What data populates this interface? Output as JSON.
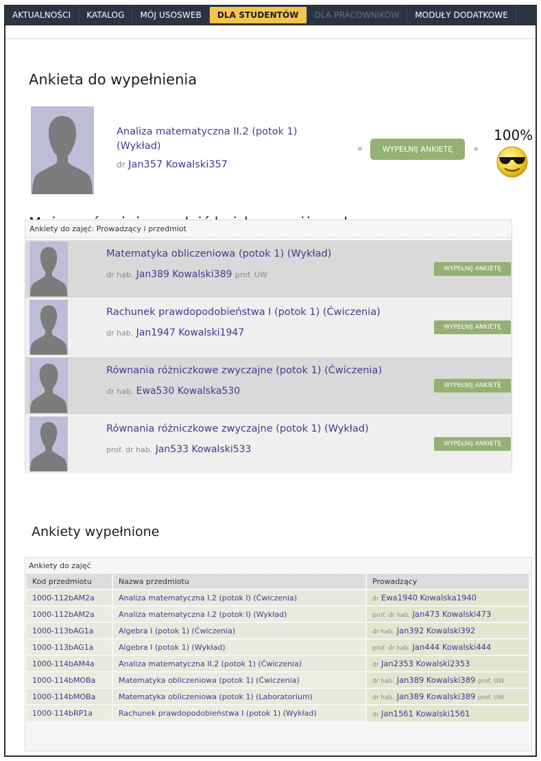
{
  "nav": {
    "tabs": [
      {
        "label": "AKTUALNOŚCI",
        "state": "normal"
      },
      {
        "label": "KATALOG",
        "state": "normal"
      },
      {
        "label": "MÓJ USOSWEB",
        "state": "normal"
      },
      {
        "label": "DLA STUDENTÓW",
        "state": "active"
      },
      {
        "label": "DLA PRACOWNIKÓW",
        "state": "disabled"
      },
      {
        "label": "MODUŁY DODATKOWE",
        "state": "normal"
      }
    ]
  },
  "to_fill": {
    "heading": "Ankieta do wypełnienia",
    "course_line1": "Analiza matematyczna II.2 (potok 1)",
    "course_line2": "(Wykład)",
    "teacher_prefix": "dr",
    "teacher_name": "Jan357 Kowalski357",
    "button": "WYPEŁNIJ ANKIETĘ",
    "progress_text": "100%",
    "progress_value": 1.0
  },
  "also": {
    "heading": "Możesz również wypełnić każdą z poniższych",
    "box_title": "Ankiety do zajęć: Prowadzący i przedmiot",
    "rows": [
      {
        "course": "Matematyka obliczeniowa (potok 1) (Wykład)",
        "pre": "dr hab.",
        "name": "Jan389 Kowalski389",
        "post": "prof. UW",
        "button": "WYPEŁNIJ ANKIETĘ"
      },
      {
        "course": "Rachunek prawdopodobieństwa I (potok 1) (Ćwiczenia)",
        "pre": "dr hab.",
        "name": "Jan1947 Kowalski1947",
        "post": "",
        "button": "WYPEŁNIJ ANKIETĘ"
      },
      {
        "course": "Równania różniczkowe zwyczajne (potok 1) (Ćwiczenia)",
        "pre": "dr hab.",
        "name": "Ewa530 Kowalska530",
        "post": "",
        "button": "WYPEŁNIJ ANKIETĘ"
      },
      {
        "course": "Równania różniczkowe zwyczajne (potok 1) (Wykład)",
        "pre": "prof. dr hab.",
        "name": "Jan533 Kowalski533",
        "post": "",
        "button": "WYPEŁNIJ ANKIETĘ"
      }
    ]
  },
  "filled": {
    "heading": "Ankiety wypełnione",
    "box_title": "Ankiety do zajęć",
    "columns": [
      "Kod przedmiotu",
      "Nazwa przedmiotu",
      "Prowadzący"
    ],
    "rows": [
      {
        "code": "1000-112bAM2a",
        "course": "Analiza matematyczna I.2 (potok I) (Ćwiczenia)",
        "pre": "dr",
        "name": "Ewa1940 Kowalska1940",
        "post": ""
      },
      {
        "code": "1000-112bAM2a",
        "course": "Analiza matematyczna I.2 (potok I) (Wykład)",
        "pre": "prof. dr hab.",
        "name": "Jan473 Kowalski473",
        "post": ""
      },
      {
        "code": "1000-113bAG1a",
        "course": "Algebra I (potok 1) (Ćwiczenia)",
        "pre": "dr hab.",
        "name": "Jan392 Kowalski392",
        "post": ""
      },
      {
        "code": "1000-113bAG1a",
        "course": "Algebra I (potok 1) (Wykład)",
        "pre": "prof. dr hab.",
        "name": "Jan444 Kowalski444",
        "post": ""
      },
      {
        "code": "1000-114bAM4a",
        "course": "Analiza matematyczna II.2 (potok 1) (Ćwiczenia)",
        "pre": "dr",
        "name": "Jan2353 Kowalski2353",
        "post": ""
      },
      {
        "code": "1000-114bMOBa",
        "course": "Matematyka obliczeniowa (potok 1) (Ćwiczenia)",
        "pre": "dr hab.",
        "name": "Jan389 Kowalski389",
        "post": "prof. UW"
      },
      {
        "code": "1000-114bMOBa",
        "course": "Matematyka obliczeniowa (potok 1) (Laboratorium)",
        "pre": "dr hab.",
        "name": "Jan389 Kowalski389",
        "post": "prof. UW"
      },
      {
        "code": "1000-114bRP1a",
        "course": "Rachunek prawdopodobieństwa I (potok 1) (Wykład)",
        "pre": "dr",
        "name": "Jan1561 Kowalski1561",
        "post": ""
      }
    ]
  },
  "colors": {
    "nav_bg": "#2b3542",
    "nav_active": "#f3c44f",
    "link": "#3f3c8f",
    "button_green": "#94b072",
    "avatar_bg": "#bdbdd8"
  }
}
